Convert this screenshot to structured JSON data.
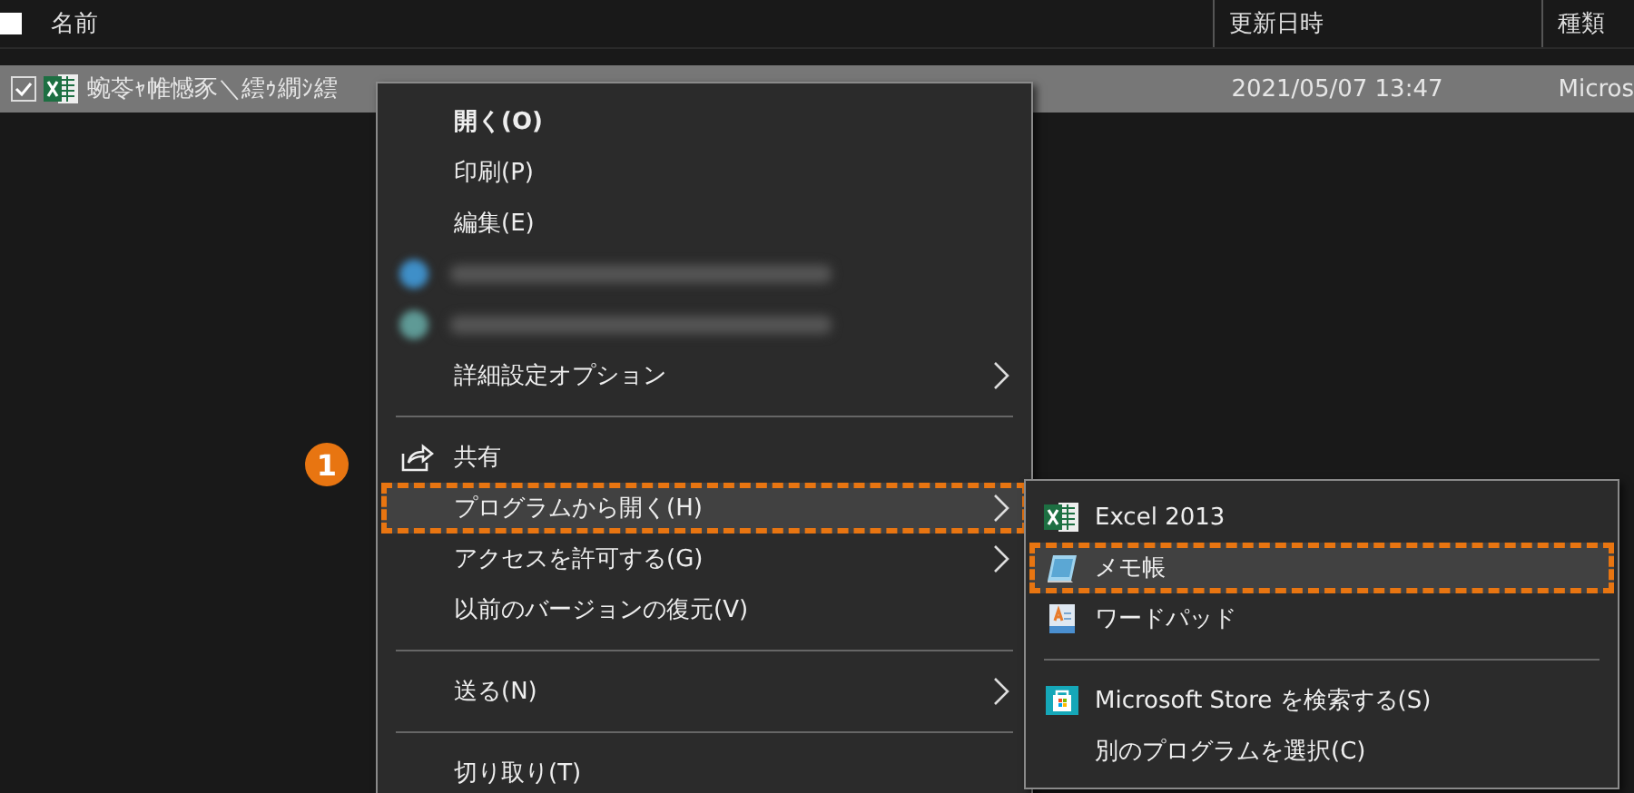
{
  "columns": [
    {
      "label": "名前"
    },
    {
      "label": "更新日時"
    },
    {
      "label": "種類"
    }
  ],
  "select_all": {
    "checked": false
  },
  "file_row": {
    "checked": true,
    "selected": true,
    "name": "蜿苓ｬ帷憾豕＼繧ｩ繝ｼ繧",
    "modified": "2021/05/07 13:47",
    "type": "Micros"
  },
  "context_menu": [
    {
      "kind": "item",
      "label": "開く(O)",
      "bold": true,
      "submenu": false,
      "selected": false,
      "annotated": false
    },
    {
      "kind": "item",
      "label": "印刷(P)",
      "bold": false,
      "submenu": false,
      "selected": false,
      "annotated": false
    },
    {
      "kind": "item",
      "label": "編集(E)",
      "bold": false,
      "submenu": false,
      "selected": false,
      "annotated": false
    },
    {
      "kind": "blurred",
      "color": "#3f8fc8"
    },
    {
      "kind": "blurred",
      "color": "#5f9a96"
    },
    {
      "kind": "item",
      "label": "詳細設定オプション",
      "bold": false,
      "submenu": true,
      "selected": false,
      "annotated": false
    },
    {
      "kind": "separator"
    },
    {
      "kind": "share",
      "label": "共有",
      "bold": false,
      "submenu": false,
      "selected": false,
      "annotated": false
    },
    {
      "kind": "item",
      "label": "プログラムから開く(H)",
      "bold": false,
      "submenu": true,
      "selected": true,
      "annotated": true
    },
    {
      "kind": "item",
      "label": "アクセスを許可する(G)",
      "bold": false,
      "submenu": true,
      "selected": false,
      "annotated": false
    },
    {
      "kind": "item",
      "label": "以前のバージョンの復元(V)",
      "bold": false,
      "submenu": false,
      "selected": false,
      "annotated": false
    },
    {
      "kind": "separator"
    },
    {
      "kind": "item",
      "label": "送る(N)",
      "bold": false,
      "submenu": true,
      "selected": false,
      "annotated": false
    },
    {
      "kind": "separator"
    },
    {
      "kind": "item",
      "label": "切り取り(T)",
      "bold": false,
      "submenu": false,
      "selected": false,
      "annotated": false
    }
  ],
  "submenu": [
    {
      "kind": "excel",
      "label": "Excel 2013",
      "selected": false,
      "annotated": false
    },
    {
      "kind": "notepad",
      "label": "メモ帳",
      "selected": true,
      "annotated": true
    },
    {
      "kind": "wordpad",
      "label": "ワードパッド",
      "selected": false,
      "annotated": false
    },
    {
      "kind": "separator"
    },
    {
      "kind": "store",
      "label": "Microsoft Store を検索する(S)",
      "selected": false,
      "annotated": false
    },
    {
      "kind": "item",
      "label": "別のプログラムを選択(C)",
      "selected": false,
      "annotated": false
    }
  ],
  "step_badge": {
    "label": "1"
  }
}
